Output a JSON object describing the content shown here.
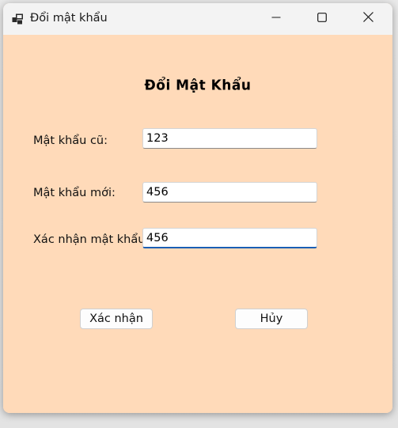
{
  "window": {
    "title": "Đổi mật khẩu",
    "icon": "app-window-icon",
    "controls": {
      "minimize": "minimize-icon",
      "maximize": "maximize-icon",
      "close": "close-icon"
    }
  },
  "form": {
    "heading": "Đổi Mật Khẩu",
    "old_password": {
      "label": "Mật khẩu cũ:",
      "value": "123"
    },
    "new_password": {
      "label": "Mật khẩu mới:",
      "value": "456"
    },
    "confirm_password": {
      "label": "Xác nhận mật khẩu:",
      "value": "456"
    },
    "buttons": {
      "confirm": "Xác nhận",
      "cancel": "Hủy"
    }
  },
  "colors": {
    "background": "#ffdab9",
    "titlebar": "#f3f3f3",
    "focus_accent": "#1a5fb4"
  }
}
